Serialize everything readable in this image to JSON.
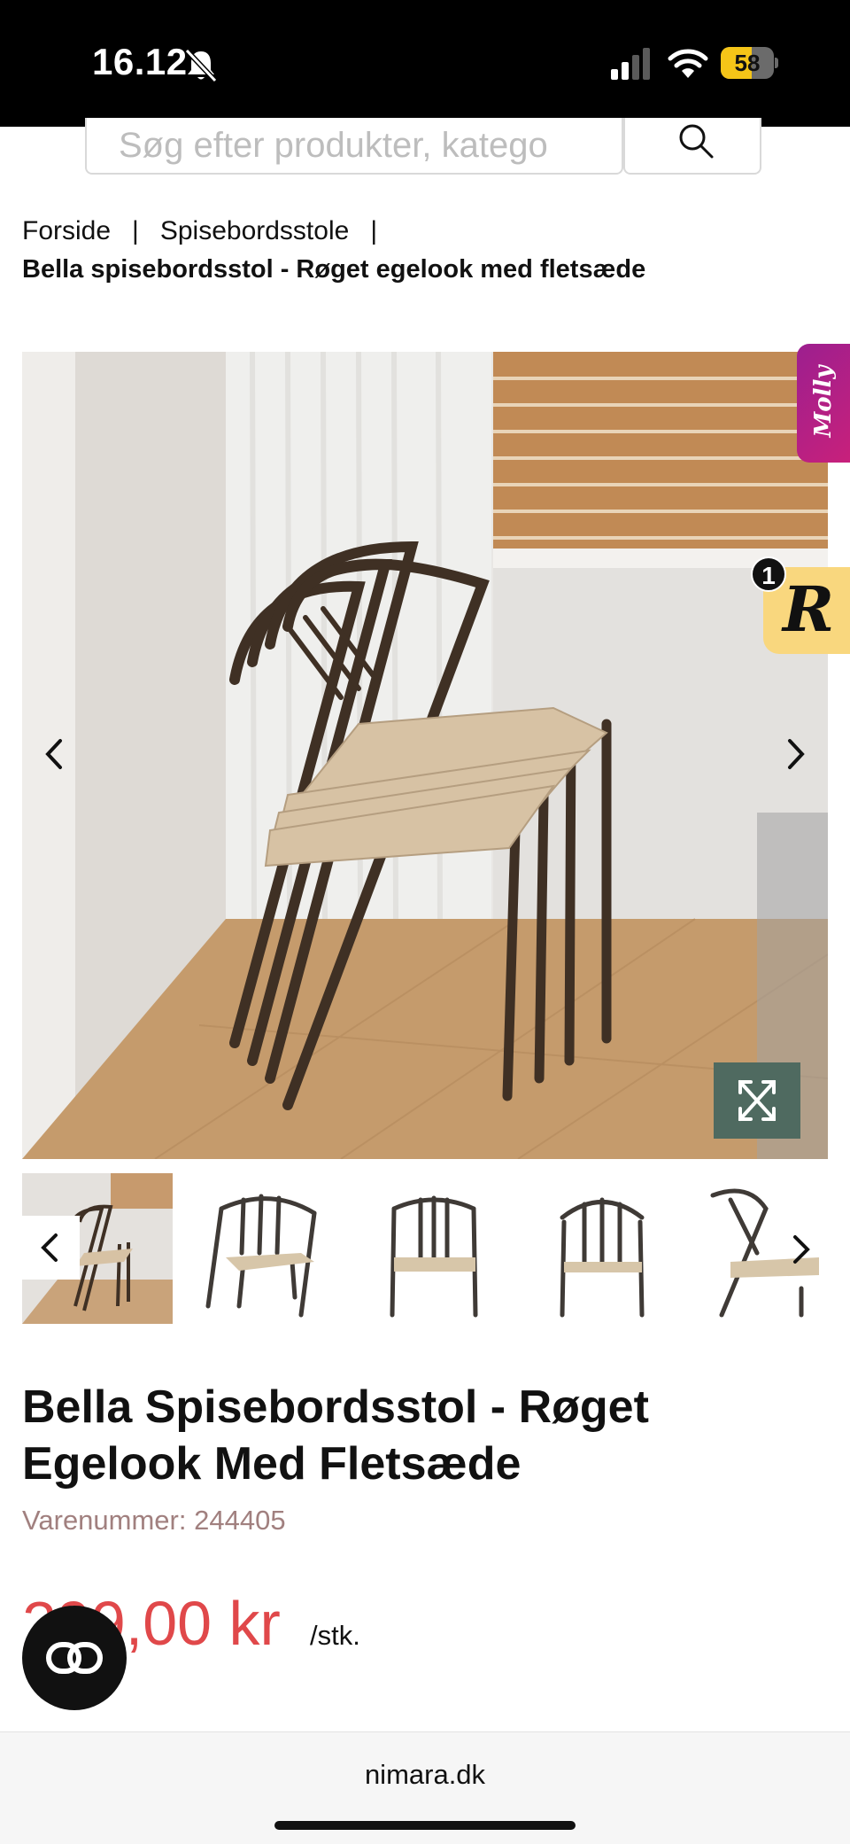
{
  "status_bar": {
    "time": "16.12",
    "battery_level": "58",
    "battery_fraction": 0.58,
    "icons": [
      "bell-slash-icon",
      "signal-icon",
      "wifi-icon",
      "battery-icon"
    ]
  },
  "search": {
    "placeholder": "Søg efter produkter, katego",
    "icon": "search-icon"
  },
  "breadcrumb": {
    "items": [
      "Forside",
      "Spisebordsstole"
    ],
    "separator": "|",
    "current": "Bella spisebordsstol - Røget egelook med fletsæde"
  },
  "gallery": {
    "prev_icon": "chevron-left-icon",
    "next_icon": "chevron-right-icon",
    "expand_icon": "expand-icon",
    "thumbnail_count_visible": 5
  },
  "widgets": {
    "molly_label": "Molly",
    "reward_letter": "R",
    "reward_count": "1"
  },
  "product": {
    "title_line1": "Bella Spisebordsstol - Røget",
    "title_line2": "Egelook Med Fletsæde",
    "sku_label": "Varenummer:",
    "sku_value": "244405",
    "price": "299,00 kr",
    "unit": "/stk."
  },
  "browser": {
    "url": "nimara.dk"
  },
  "colors": {
    "price": "#e0484a",
    "sku": "#a1807f",
    "expand_button": "#4f6a60",
    "molly_tab": "#b3208a",
    "reward_badge": "#f9d77e"
  }
}
